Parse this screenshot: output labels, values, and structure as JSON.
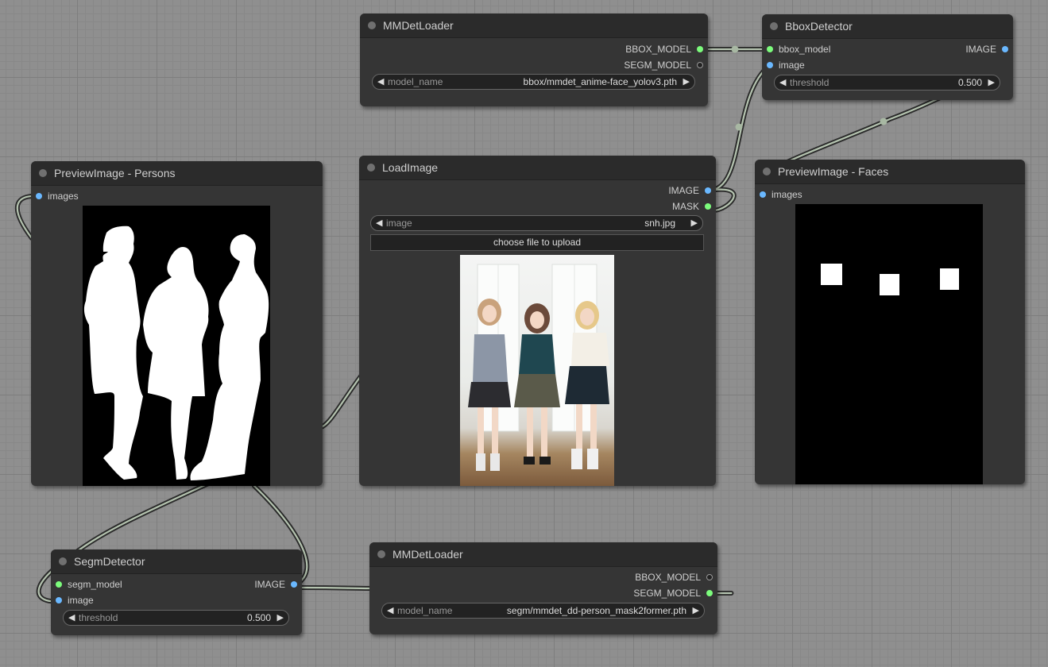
{
  "nodes": {
    "mmdet_top": {
      "title": "MMDetLoader",
      "outputs": [
        "BBOX_MODEL",
        "SEGM_MODEL"
      ],
      "widget": {
        "label": "model_name",
        "value": "bbox/mmdet_anime-face_yolov3.pth"
      }
    },
    "bbox_detector": {
      "title": "BboxDetector",
      "inputs": [
        "bbox_model",
        "image"
      ],
      "output": "IMAGE",
      "widget": {
        "label": "threshold",
        "value": "0.500"
      }
    },
    "preview_persons": {
      "title": "PreviewImage - Persons",
      "input": "images",
      "image": "person-silhouette-mask"
    },
    "load_image": {
      "title": "LoadImage",
      "outputs": [
        "IMAGE",
        "MASK"
      ],
      "widget": {
        "label": "image",
        "value": "snh.jpg"
      },
      "upload_button": "choose file to upload",
      "image": "photo-three-girls"
    },
    "preview_faces": {
      "title": "PreviewImage - Faces",
      "input": "images",
      "image": "face-bbox-mask"
    },
    "segm_detector": {
      "title": "SegmDetector",
      "inputs": [
        "segm_model",
        "image"
      ],
      "output": "IMAGE",
      "widget": {
        "label": "threshold",
        "value": "0.500"
      }
    },
    "mmdet_bottom": {
      "title": "MMDetLoader",
      "outputs": [
        "BBOX_MODEL",
        "SEGM_MODEL"
      ],
      "widget": {
        "label": "model_name",
        "value": "segm/mmdet_dd-person_mask2former.pth"
      }
    }
  },
  "colors": {
    "canvas": "#8f8f8f",
    "node_body": "#353535",
    "node_title": "#2b2b2b",
    "pin_model": "#7CFC7C",
    "pin_image": "#6ab8ff",
    "link": "#b5c4b0"
  },
  "arrows": {
    "left": "◀",
    "right": "▶"
  }
}
